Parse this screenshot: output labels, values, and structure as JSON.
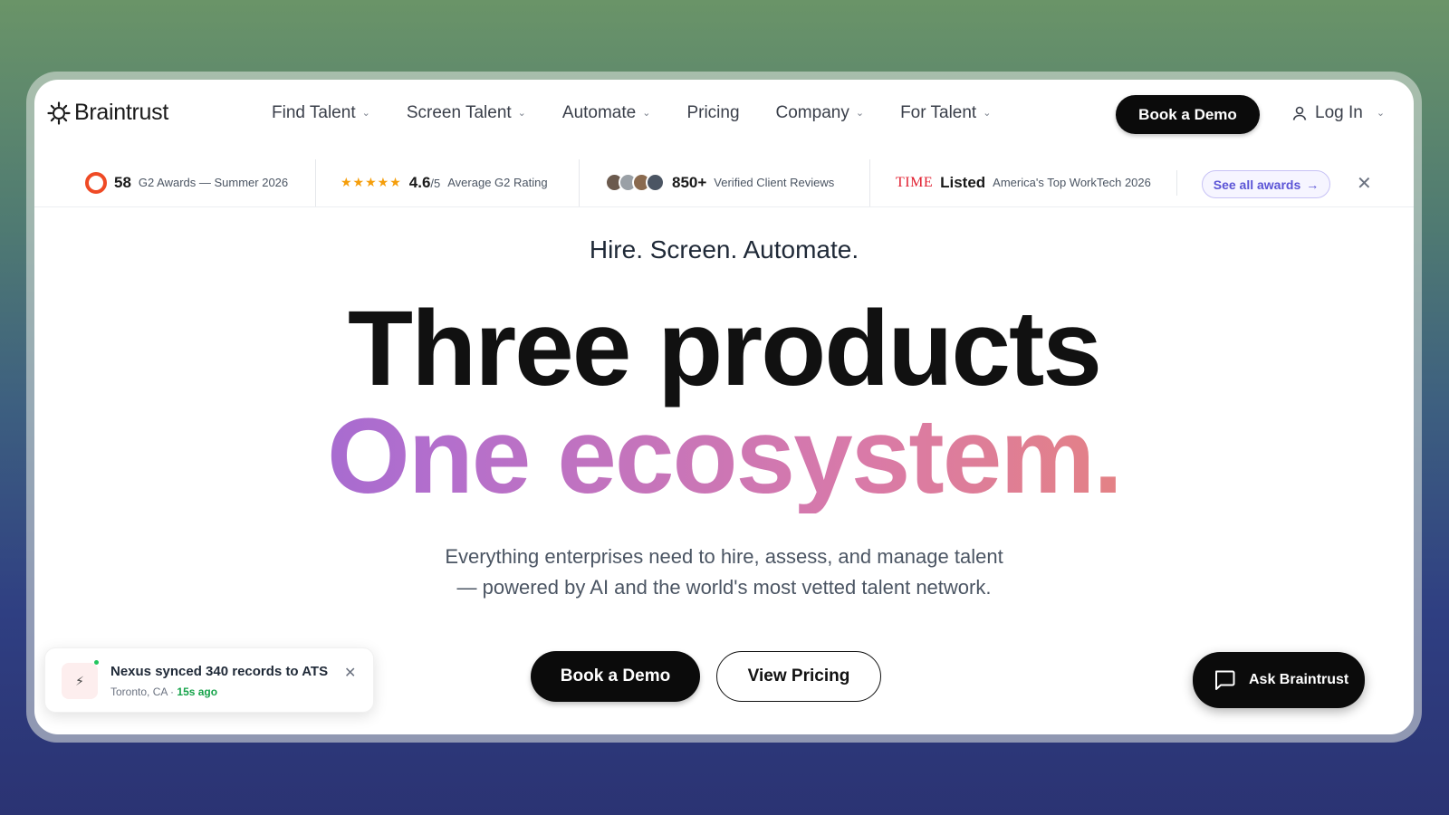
{
  "brand": {
    "name": "Braintrust",
    "icon": "sun-gear-icon"
  },
  "nav": {
    "links": [
      {
        "label": "Find Talent",
        "dropdown": true
      },
      {
        "label": "Screen Talent",
        "dropdown": true
      },
      {
        "label": "Automate",
        "dropdown": true
      },
      {
        "label": "Pricing",
        "dropdown": false
      },
      {
        "label": "Company",
        "dropdown": true
      },
      {
        "label": "For Talent",
        "dropdown": true
      }
    ],
    "book_demo": "Book a Demo",
    "login": "Log In"
  },
  "awards": {
    "g2": {
      "number": "58",
      "text": "G2 Awards — Summer 2026",
      "logo": "G"
    },
    "rating": {
      "number": "4.6",
      "denominator": "/5",
      "text": "Average G2 Rating",
      "stars": "★★★★★"
    },
    "reviews": {
      "number": "850+",
      "text": "Verified Client Reviews",
      "avatar_colors": [
        "#6b5a4e",
        "#9aa0a6",
        "#8a6a4f",
        "#4b5563"
      ]
    },
    "time": {
      "logo": "TIME",
      "number": "Listed",
      "text": "America's Top WorkTech 2026"
    },
    "see_all": "See all awards",
    "close": "✕"
  },
  "hero": {
    "tagline": "Hire. Screen. Automate.",
    "headline_1": "Three products",
    "headline_2": "One ecosystem.",
    "subtitle_1": "Everything enterprises need to hire, assess, and manage talent",
    "subtitle_2": "— powered by AI and the world's most vetted talent network.",
    "cta_primary": "Book a Demo",
    "cta_secondary": "View Pricing"
  },
  "toast": {
    "title": "Nexus synced 340 records to ATS",
    "location": "Toronto, CA",
    "separator": "·",
    "time": "15s ago",
    "close": "✕",
    "icon": "bolt-icon"
  },
  "chat": {
    "label": "Ask Braintrust",
    "icon": "chat-bubble-icon"
  },
  "colors": {
    "accent_purple": "#8a63d9",
    "accent_orange": "#f08a5d",
    "primary_button": "#0b0b0b",
    "award_link": "#5b54d6",
    "g2_red": "#ef4a25",
    "time_red": "#e11d2e"
  }
}
